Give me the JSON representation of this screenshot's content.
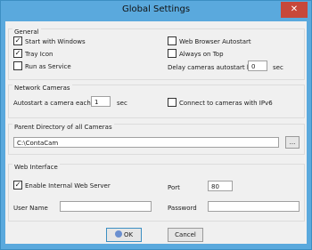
{
  "window": {
    "title": "Global Settings",
    "close_glyph": "✕"
  },
  "general": {
    "title": "General",
    "start_with_windows": {
      "label": "Start with Windows",
      "checked": true
    },
    "tray_icon": {
      "label": "Tray Icon",
      "checked": true
    },
    "run_as_service": {
      "label": "Run as Service",
      "checked": false
    },
    "web_browser_autostart": {
      "label": "Web Browser Autostart",
      "checked": false
    },
    "always_on_top": {
      "label": "Always on Top",
      "checked": false
    },
    "delay_label": "Delay cameras autostart by",
    "delay_value": "0",
    "delay_unit": "sec"
  },
  "network": {
    "title": "Network Cameras",
    "autostart_label": "Autostart a camera each",
    "autostart_value": "1",
    "autostart_unit": "sec",
    "ipv6": {
      "label": "Connect to cameras with IPv6",
      "checked": false
    }
  },
  "parent_dir": {
    "title": "Parent Directory of all Cameras",
    "path": "C:\\ContaCam",
    "browse_label": "..."
  },
  "web": {
    "title": "Web Interface",
    "enable_server": {
      "label": "Enable Internal Web Server",
      "checked": true
    },
    "port_label": "Port",
    "port_value": "80",
    "username_label": "User Name",
    "username_value": "",
    "password_label": "Password",
    "password_value": ""
  },
  "buttons": {
    "ok": "OK",
    "cancel": "Cancel"
  },
  "colors": {
    "titlebar": "#5aa9dd",
    "close": "#c7483a",
    "client": "#f0f0f0"
  },
  "icons": {
    "close": "close-icon",
    "check": "checkmark-icon",
    "ok": "shield-icon"
  }
}
